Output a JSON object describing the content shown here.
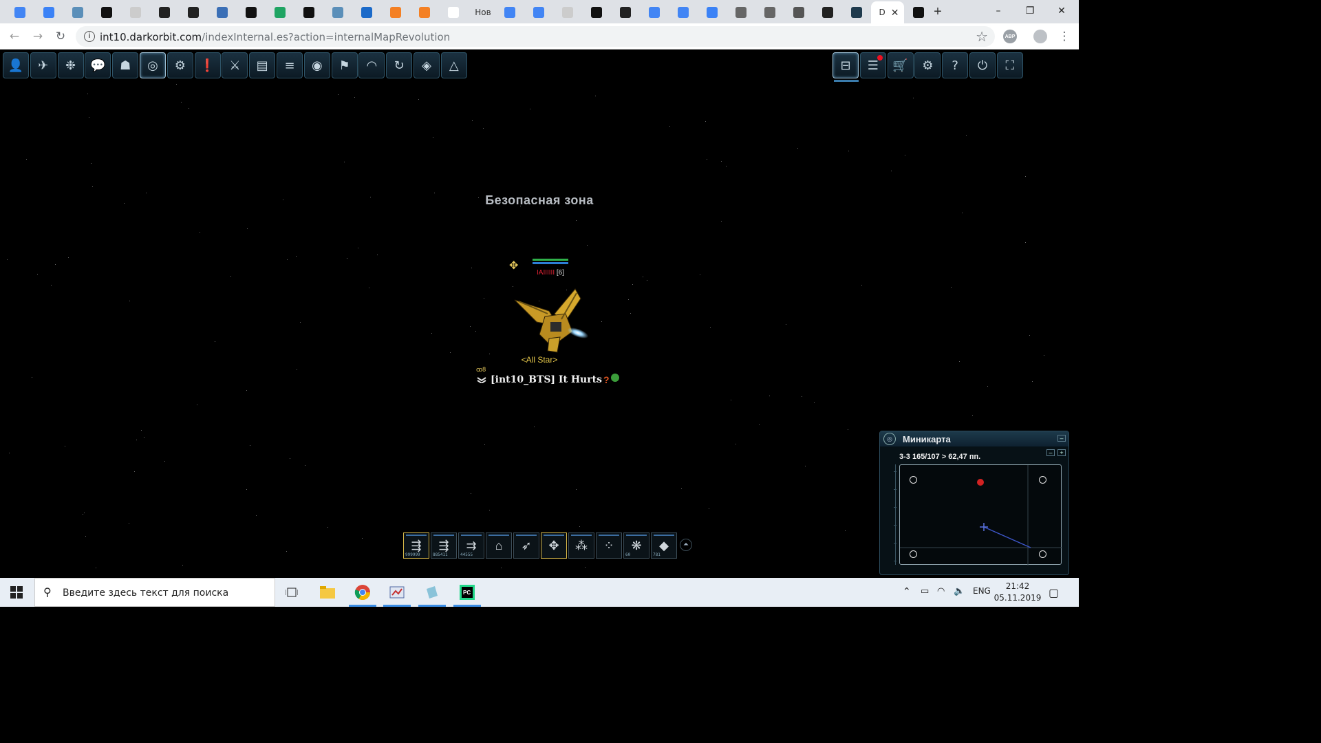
{
  "browser": {
    "tabs": [
      {
        "icon": "google-icon",
        "label": ""
      },
      {
        "icon": "chat-icon",
        "label": ""
      },
      {
        "icon": "h-icon",
        "label": ""
      },
      {
        "icon": "m-icon",
        "label": ""
      },
      {
        "icon": "blank-page-icon",
        "label": ""
      },
      {
        "icon": "glasses-icon",
        "label": ""
      },
      {
        "icon": "glasses-icon",
        "label": ""
      },
      {
        "icon": "bank-icon",
        "label": ""
      },
      {
        "icon": "github-icon",
        "label": ""
      },
      {
        "icon": "drive-icon",
        "label": ""
      },
      {
        "icon": "t-icon",
        "label": ""
      },
      {
        "icon": "h-icon",
        "label": ""
      },
      {
        "icon": "stack-icon",
        "label": ""
      },
      {
        "icon": "stackoverflow-icon",
        "label": ""
      },
      {
        "icon": "stackoverflow-icon",
        "label": ""
      },
      {
        "icon": "yn-icon",
        "label": ""
      },
      {
        "icon": "",
        "label": "Нов"
      },
      {
        "icon": "google-icon",
        "label": ""
      },
      {
        "icon": "google-icon",
        "label": ""
      },
      {
        "icon": "blank-page-icon",
        "label": ""
      },
      {
        "icon": "github-icon",
        "label": ""
      },
      {
        "icon": "glasses-icon",
        "label": ""
      },
      {
        "icon": "google-icon",
        "label": ""
      },
      {
        "icon": "google-icon",
        "label": ""
      },
      {
        "icon": "network-icon",
        "label": ""
      },
      {
        "icon": "globe-icon",
        "label": ""
      },
      {
        "icon": "globe-icon",
        "label": ""
      },
      {
        "icon": "incognito-icon",
        "label": ""
      },
      {
        "icon": "glasses-icon",
        "label": ""
      },
      {
        "icon": "darkorbit-icon",
        "label": ""
      },
      {
        "icon": "",
        "label": "D",
        "active": true
      },
      {
        "icon": "github-icon",
        "label": ""
      }
    ],
    "new_tab": "+",
    "window_controls": {
      "minimize": "–",
      "maximize": "❐",
      "close": "✕"
    },
    "url_host": "int10.darkorbit.com",
    "url_path": "/indexInternal.es?action=internalMapRevolution",
    "info_icon": "i",
    "star_icon": "☆",
    "ext_abp": "ABP",
    "menu_dots": "⋮"
  },
  "game": {
    "top_menu": [
      {
        "icon": "user-icon",
        "glyph": "👤"
      },
      {
        "icon": "ship-icon",
        "glyph": "✈"
      },
      {
        "icon": "drone-icon",
        "glyph": "❉"
      },
      {
        "icon": "chat-icon",
        "glyph": "💬"
      },
      {
        "icon": "group-icon",
        "glyph": "☗"
      },
      {
        "icon": "minimap-toggle-icon",
        "glyph": "◎",
        "selected": true
      },
      {
        "icon": "pet-icon",
        "glyph": "⚙"
      },
      {
        "icon": "quest-icon",
        "glyph": "❗"
      },
      {
        "icon": "weapon-icon",
        "glyph": "⚔"
      },
      {
        "icon": "log-icon",
        "glyph": "▤"
      },
      {
        "icon": "list-icon",
        "glyph": "≡"
      },
      {
        "icon": "location-icon",
        "glyph": "◉"
      },
      {
        "icon": "clan-icon",
        "glyph": "⚑"
      },
      {
        "icon": "speed-icon",
        "glyph": "◠"
      },
      {
        "icon": "refresh-icon",
        "glyph": "↻"
      },
      {
        "icon": "mask-icon",
        "glyph": "◈"
      },
      {
        "icon": "triangle-icon",
        "glyph": "△"
      }
    ],
    "right_menu": [
      {
        "icon": "window-icon",
        "glyph": "⊟",
        "selected": true
      },
      {
        "icon": "notifications-icon",
        "glyph": "☰"
      },
      {
        "icon": "cart-icon",
        "glyph": "🛒"
      },
      {
        "icon": "settings-icon",
        "glyph": "⚙"
      },
      {
        "icon": "help-icon",
        "glyph": "?"
      },
      {
        "icon": "power-icon",
        "glyph": "⏻"
      },
      {
        "icon": "fullscreen-icon",
        "glyph": "⛶"
      }
    ],
    "zone_text": "Безопасная зона",
    "ship": {
      "title": "<All Star>",
      "rank_tag": "[6]",
      "pilot_name": "[int10_BTS] It  Hurts",
      "pilot_badge": "?",
      "gold_marker": "ꝏ8",
      "drone_formation": "✥"
    },
    "hp_colors": {
      "hp": "#2fb14a",
      "shield": "#2c7fd6"
    },
    "action_bar": [
      {
        "icon": "laser-ammo-icon",
        "glyph": "⇶",
        "count": "999999",
        "selected": true
      },
      {
        "icon": "laser-ammo-x4-icon",
        "glyph": "⇶",
        "count": "885411"
      },
      {
        "icon": "rocket-ammo-icon",
        "glyph": "⇉",
        "count": "44555"
      },
      {
        "icon": "jump-icon",
        "glyph": "⌂",
        "count": ""
      },
      {
        "icon": "rocket-launcher-icon",
        "glyph": "➶",
        "count": ""
      },
      {
        "icon": "formation-star-icon",
        "glyph": "✥",
        "count": "",
        "selected": true
      },
      {
        "icon": "formation-arrow-icon",
        "glyph": "⁂",
        "count": ""
      },
      {
        "icon": "formation-wave-icon",
        "glyph": "⁘",
        "count": ""
      },
      {
        "icon": "pet-ability-icon",
        "glyph": "❋",
        "count": "60"
      },
      {
        "icon": "mine-icon",
        "glyph": "◆",
        "count": "781"
      }
    ],
    "action_bar_expand": "⏶",
    "minimap": {
      "title": "Миникарта",
      "coords": "3-3  165/107 > 62,47 пп.",
      "minimize": "–",
      "zoom_out": "–",
      "zoom_in": "+",
      "player_marker_color": "#3d56c9",
      "enemy_marker_color": "#d22222"
    }
  },
  "taskbar": {
    "search_placeholder": "Введите здесь текст для поиска",
    "language": "ENG",
    "time": "21:42",
    "date": "05.11.2019"
  }
}
